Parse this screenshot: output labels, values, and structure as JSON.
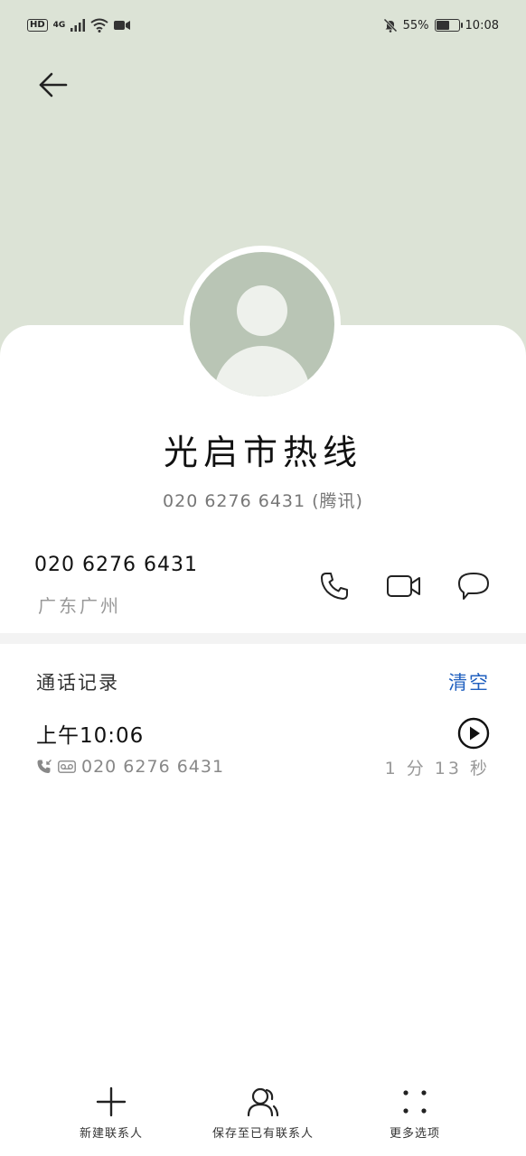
{
  "status_bar": {
    "hd": "HD",
    "network": "4G",
    "battery_text": "55%",
    "battery_level": 0.55,
    "time": "10:08"
  },
  "contact": {
    "name": "光启市热线",
    "subtitle": "020 6276 6431 (腾讯)",
    "number": "020 6276 6431",
    "location": "广东广州"
  },
  "call_log": {
    "title": "通话记录",
    "clear_label": "清空",
    "items": [
      {
        "time": "上午10:06",
        "number": "020 6276 6431",
        "duration": "1 分 13 秒"
      }
    ]
  },
  "bottom_bar": {
    "new_contact": "新建联系人",
    "save_existing": "保存至已有联系人",
    "more_options": "更多选项"
  },
  "colors": {
    "header_bg": "#dce3d6",
    "accent": "#1f5fbf",
    "avatar_bg": "#b9c5b5"
  }
}
